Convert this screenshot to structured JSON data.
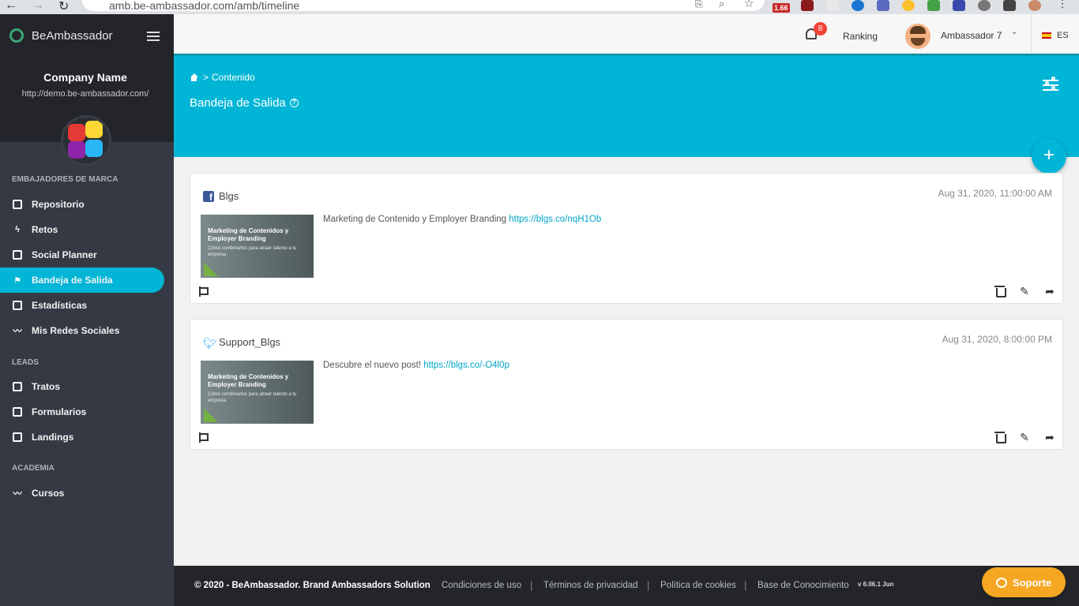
{
  "browser": {
    "url": "amb.be-ambassador.com/amb/timeline",
    "extension_badge": "1.66"
  },
  "sidebar": {
    "brand": "BeAmbassador",
    "company_name": "Company Name",
    "company_url": "http://demo.be-ambassador.com/",
    "sections": [
      {
        "title": "EMBAJADORES DE MARCA",
        "items": [
          {
            "label": "Repositorio",
            "icon": "list-icon"
          },
          {
            "label": "Retos",
            "icon": "bolt-icon"
          },
          {
            "label": "Social Planner",
            "icon": "calendar-icon"
          },
          {
            "label": "Bandeja de Salida",
            "icon": "flag-icon",
            "active": true
          },
          {
            "label": "Estadísticas",
            "icon": "chart-icon"
          },
          {
            "label": "Mis Redes Sociales",
            "icon": "trend-icon"
          }
        ]
      },
      {
        "title": "LEADS",
        "items": [
          {
            "label": "Tratos",
            "icon": "briefcase-icon"
          },
          {
            "label": "Formularios",
            "icon": "form-icon"
          },
          {
            "label": "Landings",
            "icon": "landing-icon"
          }
        ]
      },
      {
        "title": "ACADEMIA",
        "items": [
          {
            "label": "Cursos",
            "icon": "trend-icon"
          }
        ]
      }
    ]
  },
  "topbar": {
    "notification_count": "8",
    "ranking_label": "Ranking",
    "user_name": "Ambassador 7",
    "language": "ES"
  },
  "banner": {
    "breadcrumb": "Contenido",
    "title": "Bandeja de Salida"
  },
  "posts": [
    {
      "network": "facebook",
      "account": "Blgs",
      "date": "Aug 31, 2020, 11:00:00 AM",
      "text": "Marketing de Contenido y Employer Branding ",
      "link": "https://blgs.co/nqH1Ob",
      "thumb_title": "Marketing de Contenidos y Employer Branding",
      "thumb_subtitle": "Cómo combinarlos para atraer talento a tu empresa"
    },
    {
      "network": "twitter",
      "account": "Support_Blgs",
      "date": "Aug 31, 2020, 8:00:00 PM",
      "text": "Descubre el nuevo post! ",
      "link": "https://blgs.co/-O4l0p",
      "thumb_title": "Marketing de Contenidos y Employer Branding",
      "thumb_subtitle": "Cómo combinarlos para atraer talento a tu empresa"
    }
  ],
  "footer": {
    "copyright": "© 2020 - BeAmbassador. Brand Ambassadors Solution",
    "links": [
      "Condiciones de uso",
      "Términos de privacidad",
      "Política de cookies",
      "Base de Conocimiento"
    ],
    "version": "v 6.06.1 Jun",
    "support_label": "Soporte"
  },
  "colors": {
    "accent": "#00b5d6",
    "sidebar": "#353943",
    "footer": "#23252b",
    "support": "#f5a623"
  }
}
